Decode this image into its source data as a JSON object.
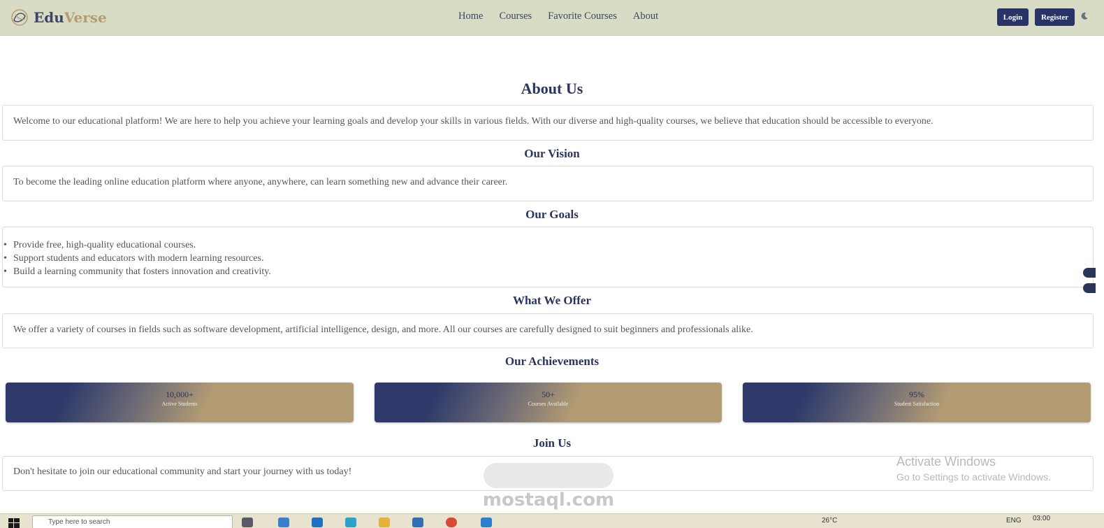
{
  "navbar": {
    "brand_part1": "Edu",
    "brand_part2": "Verse",
    "links": [
      "Home",
      "Courses",
      "Favorite Courses",
      "About"
    ],
    "login_label": "Login",
    "register_label": "Register",
    "theme_toggle_icon": "moon-icon"
  },
  "about": {
    "title": "About Us",
    "intro": "Welcome to our educational platform! We are here to help you achieve your learning goals and develop your skills in various fields. With our diverse and high-quality courses, we believe that education should be accessible to everyone.",
    "vision_title": "Our Vision",
    "vision_text": "To become the leading online education platform where anyone, anywhere, can learn something new and advance their career.",
    "goals_title": "Our Goals",
    "goals": [
      "Provide free, high-quality educational courses.",
      "Support students and educators with modern learning resources.",
      "Build a learning community that fosters innovation and creativity."
    ],
    "offer_title": "What We Offer",
    "offer_text": "We offer a variety of courses in fields such as software development, artificial intelligence, design, and more. All our courses are carefully designed to suit beginners and professionals alike.",
    "achievements_title": "Our Achievements",
    "achievements": [
      {
        "value": "10,000+",
        "label": "Active Students"
      },
      {
        "value": "50+",
        "label": "Courses Available"
      },
      {
        "value": "95%",
        "label": "Student Satisfaction"
      }
    ],
    "join_title": "Join Us",
    "join_text": "Don't hesitate to join our educational community and start your journey with us today!"
  },
  "overlay": {
    "activate_title": "Activate Windows",
    "activate_sub": "Go to Settings to activate Windows.",
    "watermark_text": "mostaql.com"
  },
  "taskbar": {
    "search_placeholder": "Type here to search",
    "weather": "26°C",
    "language": "ENG",
    "time": "03:00"
  },
  "colors": {
    "navbar_bg": "#d9dcc4",
    "primary": "#2a3366",
    "accent": "#b39c74",
    "heading": "#2b3360"
  }
}
